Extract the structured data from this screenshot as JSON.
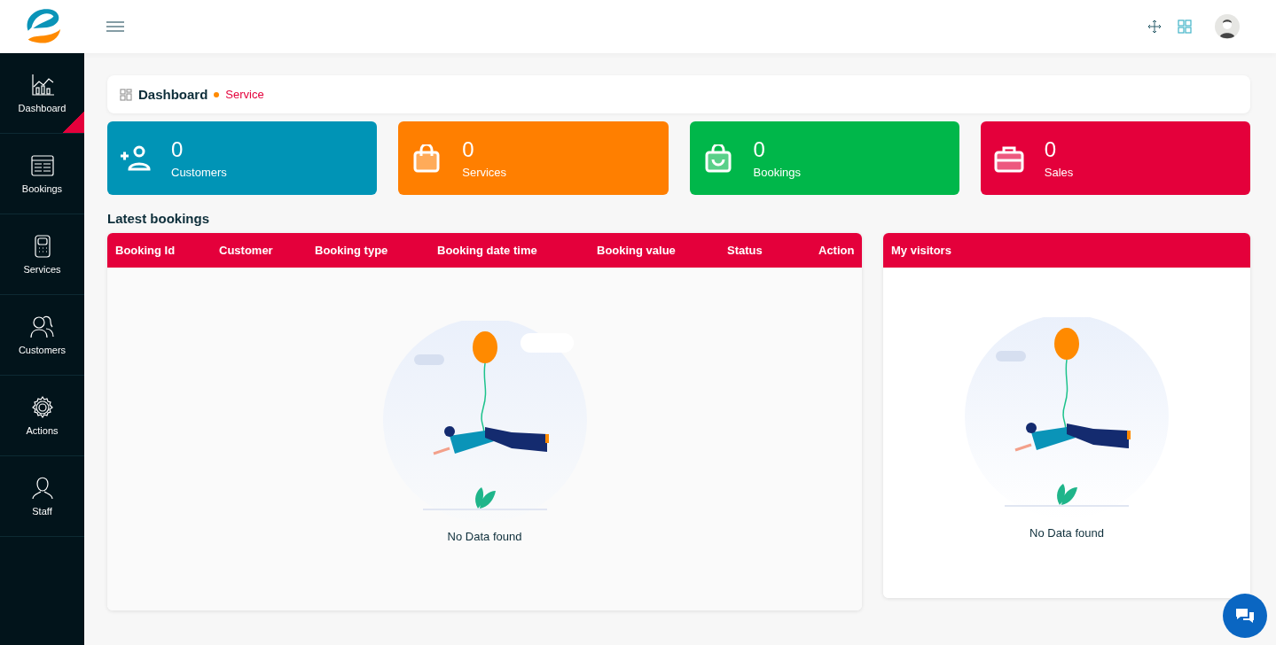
{
  "sidebar": {
    "items": [
      {
        "label": "Dashboard",
        "kind": "chart",
        "selected": true
      },
      {
        "label": "Bookings",
        "kind": "list",
        "selected": false
      },
      {
        "label": "Services",
        "kind": "device",
        "selected": false
      },
      {
        "label": "Customers",
        "kind": "people",
        "selected": false
      },
      {
        "label": "Actions",
        "kind": "gear",
        "selected": false
      },
      {
        "label": "Staff",
        "kind": "person",
        "selected": false
      }
    ]
  },
  "breadcrumb": {
    "title": "Dashboard",
    "current": "Service"
  },
  "stats": [
    {
      "value": "0",
      "label": "Customers",
      "kind": "add-user",
      "color": "#0094b6"
    },
    {
      "value": "0",
      "label": "Services",
      "kind": "bag",
      "color": "#ff7f00"
    },
    {
      "value": "0",
      "label": "Bookings",
      "kind": "bag-check",
      "color": "#00b74a"
    },
    {
      "value": "0",
      "label": "Sales",
      "kind": "briefcase",
      "color": "#e4003b"
    }
  ],
  "latest_bookings": {
    "title": "Latest bookings",
    "columns": [
      "Booking Id",
      "Customer",
      "Booking type",
      "Booking date time",
      "Booking value",
      "Status",
      "Action"
    ],
    "empty_text": "No Data found"
  },
  "visitors": {
    "title": "My visitors",
    "empty_text": "No Data found"
  }
}
